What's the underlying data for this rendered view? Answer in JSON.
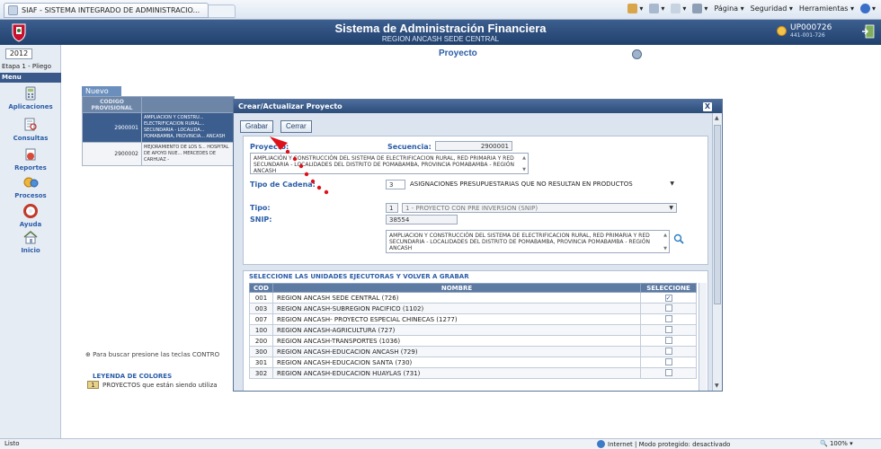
{
  "browser": {
    "tab_title": "SIAF - SISTEMA INTEGRADO DE ADMINISTRACIO...",
    "tools": {
      "page": "Página ▾",
      "security": "Seguridad ▾",
      "tools": "Herramientas ▾"
    }
  },
  "header": {
    "title": "Sistema de Administración Financiera",
    "subtitle": "REGION ANCASH SEDE CENTRAL",
    "user_name": "UP000726",
    "user_id": "441-001-726"
  },
  "sidebar": {
    "year": "2012",
    "stage": "Etapa 1 - Pliego",
    "menu_label": "Menu",
    "items": [
      {
        "label": "Aplicaciones"
      },
      {
        "label": "Consultas"
      },
      {
        "label": "Reportes"
      },
      {
        "label": "Procesos"
      },
      {
        "label": "Ayuda"
      },
      {
        "label": "Inicio"
      }
    ]
  },
  "main": {
    "title": "Proyecto",
    "new_tab": "Nuevo",
    "table_header_cod": "CODIGO PROVISIONAL",
    "rows": [
      {
        "cod": "2900001",
        "desc": "AMPLIACION Y CONSTRU... ELECTRIFICACION RURAL... SECUNDARIA - LOCALIDA... POMABAMBA, PROVINCIA... ANCASH"
      },
      {
        "cod": "2900002",
        "desc": "MEJORAMIENTO DE LOS S... HOSPITAL DE APOYO NUE... MERCEDES DE CARHUAZ -"
      }
    ],
    "search_hint": "Para buscar presione las teclas CONTRO",
    "legend_title": "LEYENDA DE COLORES",
    "legend_num": "1",
    "legend_text": "PROYECTOS que están siendo utiliza"
  },
  "modal": {
    "title": "Crear/Actualizar Proyecto",
    "close_label": "X",
    "save_label": "Grabar",
    "close_button_label": "Cerrar",
    "proyecto_label": "Proyecto:",
    "secuencia_label": "Secuencia:",
    "secuencia_value": "2900001",
    "proyecto_desc": "AMPLIACIÓN Y CONSTRUCCIÓN DEL SISTEMA DE ELECTRIFICACION RURAL, RED PRIMARIA Y RED SECUNDARIA - LOCALIDADES DEL DISTRITO DE POMABAMBA, PROVINCIA POMABAMBA - REGIÓN ANCASH",
    "tipo_cadena_label": "Tipo de Cadena:",
    "tipo_cadena_code": "3",
    "tipo_cadena_value": "ASIGNACIONES PRESUPUESTARIAS QUE NO RESULTAN EN PRODUCTOS",
    "tipo_label": "Tipo:",
    "tipo_code": "1",
    "tipo_value": "1 - PROYECTO CON PRE INVERSION (SNIP)",
    "snip_label": "SNIP:",
    "snip_value": "38554",
    "snip_desc": "AMPLIACION Y CONSTRUCCIÓN DEL SISTEMA DE ELECTRIFICACION RURAL, RED PRIMARIA Y RED SECUNDARIA - LOCALIDADES DEL DISTRITO DE POMABAMBA, PROVINCIA POMABAMBA - REGIÓN ANCASH",
    "ue_title": "SELECCIONE LAS UNIDADES EJECUTORAS Y VOLVER A GRABAR",
    "ue_columns": {
      "cod": "COD",
      "nombre": "NOMBRE",
      "seleccione": "SELECCIONE"
    },
    "ue_rows": [
      {
        "cod": "001",
        "nombre": "REGION ANCASH SEDE CENTRAL (726)",
        "checked": true
      },
      {
        "cod": "003",
        "nombre": "REGION ANCASH-SUBREGION PACIFICO (1102)",
        "checked": false
      },
      {
        "cod": "007",
        "nombre": "REGION ANCASH- PROYECTO ESPECIAL CHINECAS (1277)",
        "checked": false
      },
      {
        "cod": "100",
        "nombre": "REGION ANCASH-AGRICULTURA (727)",
        "checked": false
      },
      {
        "cod": "200",
        "nombre": "REGION ANCASH-TRANSPORTES (1036)",
        "checked": false
      },
      {
        "cod": "300",
        "nombre": "REGION ANCASH-EDUCACION ANCASH (729)",
        "checked": false
      },
      {
        "cod": "301",
        "nombre": "REGION ANCASH-EDUCACION SANTA (730)",
        "checked": false
      },
      {
        "cod": "302",
        "nombre": "REGION ANCASH-EDUCACION HUAYLAS (731)",
        "checked": false
      }
    ]
  },
  "status_bar": {
    "left": "Listo",
    "internet": "Internet | Modo protegido: desactivado",
    "zoom": "🔍 100% ▾"
  },
  "colors": {
    "header": "#2d4d7a",
    "accent": "#2a5da8",
    "annotation": "#e0101a"
  }
}
